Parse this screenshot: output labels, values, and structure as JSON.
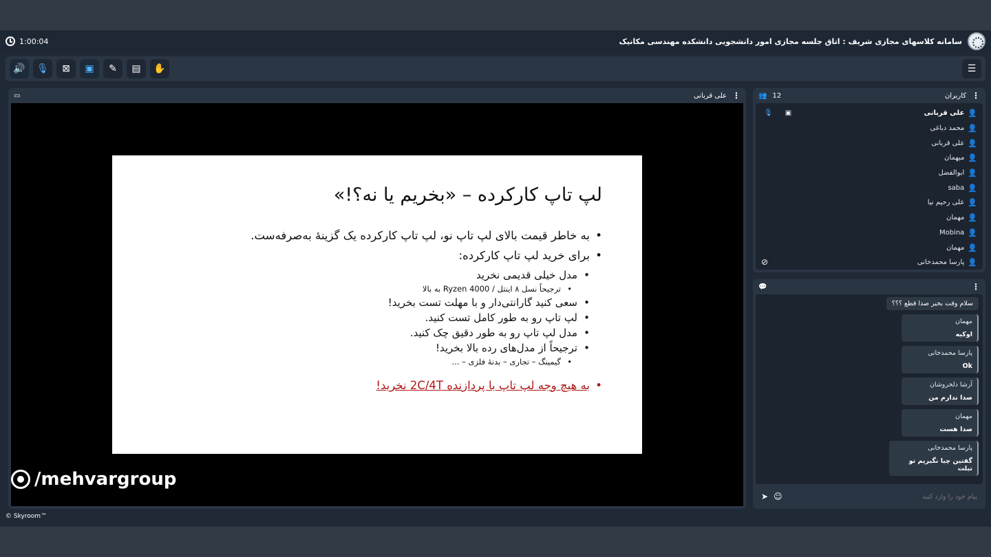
{
  "session": {
    "timer": "1:00:04",
    "title": "سامانه کلاسهای مجازی شریف : اتاق جلسه مجازی امور دانشجویی دانشکده مهندسی مکانیک"
  },
  "toolbar": {
    "icons": [
      "speaker-icon",
      "microphone-icon",
      "camera-off-icon",
      "screen-share-icon",
      "brush-icon",
      "file-icon",
      "hand-icon",
      "menu-icon"
    ]
  },
  "presenter": {
    "name": "علی قربانی"
  },
  "slide": {
    "title": "لپ تاپ کارکرده – «بخریم یا نه؟!»",
    "b1": "به خاطر قیمت بالای لپ تاپ نو، لپ تاپ کارکرده یک گزینۀ به‌صرفه‌ست.",
    "b2": "برای خرید لپ تاپ کارکرده:",
    "s1": "مدل خیلی قدیمی نخرید",
    "s1a": "ترجیحاً نسل ۸ اینتل / Ryzen 4000 به بالا",
    "s2": "سعی کنید گارانتی‌دار و با مهلت تست بخرید!",
    "s3": "لپ تاپ رو به طور کامل تست کنید.",
    "s4": "مدل لپ تاپ رو به طور دقیق چک کنید.",
    "s5": "ترجیحاً از مدل‌های رده بالا بخرید!",
    "s5a": "گیمینگ – تجاری – بدنۀ فلزی – ...",
    "warn": "به هیچ وجه لپ تاپ با پردازنده 2C/4T نخرید!"
  },
  "watermark": "/mehvargroup",
  "users": {
    "title": "کاربران",
    "count": "12",
    "list": [
      {
        "name": "علی قربانی"
      },
      {
        "name": "محمد دباغی"
      },
      {
        "name": "علی قربانی"
      },
      {
        "name": "میهمان"
      },
      {
        "name": "ابوالفضل"
      },
      {
        "name": "saba"
      },
      {
        "name": "علی رحیم نیا"
      },
      {
        "name": "مهمان"
      },
      {
        "name": "Mobina"
      },
      {
        "name": "مهمان"
      },
      {
        "name": "پارسا محمدخانی"
      }
    ]
  },
  "chat": {
    "messages": [
      {
        "sender": "",
        "text": "سلام وقت بخیر صدا قطع ؟؟؟"
      },
      {
        "sender": "مهمان",
        "text": "اوکیه"
      },
      {
        "sender": "پارسا محمدخانی",
        "text": "Ok"
      },
      {
        "sender": "آرشا دلخروشان",
        "text": "صدا ندارم من"
      },
      {
        "sender": "مهمان",
        "text": "صدا هست"
      },
      {
        "sender": "پارسا محمدخانی",
        "text": "گفتین چیا نگیریم تو تبلت"
      }
    ],
    "placeholder": "پیام خود را وارد کنید"
  },
  "footer": "© Skyroom™"
}
